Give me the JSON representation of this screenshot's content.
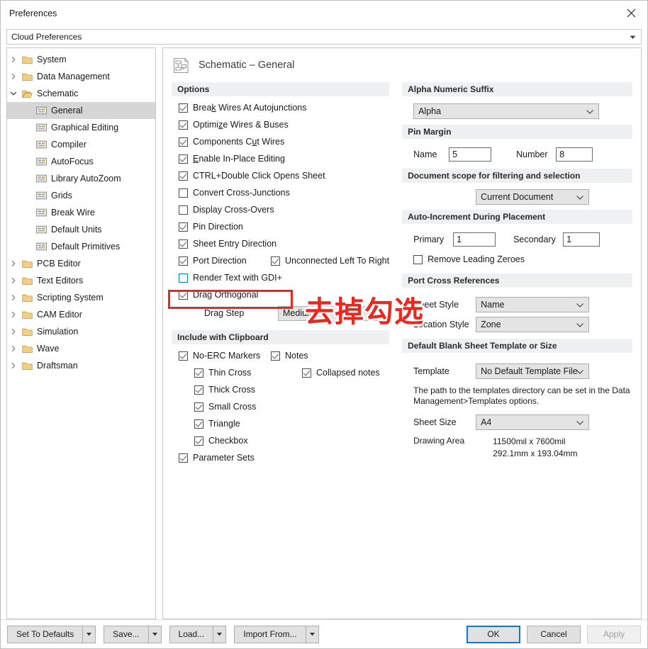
{
  "window": {
    "title": "Preferences",
    "close_icon": "close-icon"
  },
  "profile": {
    "value": "Cloud Preferences"
  },
  "tree": {
    "items": [
      {
        "label": "System",
        "level": 0,
        "expandable": true,
        "expanded": false,
        "icon": "folder-icon",
        "selected": false
      },
      {
        "label": "Data Management",
        "level": 0,
        "expandable": true,
        "expanded": false,
        "icon": "folder-icon",
        "selected": false
      },
      {
        "label": "Schematic",
        "level": 0,
        "expandable": true,
        "expanded": true,
        "icon": "folder-open-icon",
        "selected": false
      },
      {
        "label": "General",
        "level": 1,
        "expandable": false,
        "expanded": false,
        "icon": "page-icon",
        "selected": true
      },
      {
        "label": "Graphical Editing",
        "level": 1,
        "expandable": false,
        "expanded": false,
        "icon": "page-icon",
        "selected": false
      },
      {
        "label": "Compiler",
        "level": 1,
        "expandable": false,
        "expanded": false,
        "icon": "page-icon",
        "selected": false
      },
      {
        "label": "AutoFocus",
        "level": 1,
        "expandable": false,
        "expanded": false,
        "icon": "page-icon",
        "selected": false
      },
      {
        "label": "Library AutoZoom",
        "level": 1,
        "expandable": false,
        "expanded": false,
        "icon": "page-icon",
        "selected": false
      },
      {
        "label": "Grids",
        "level": 1,
        "expandable": false,
        "expanded": false,
        "icon": "page-icon",
        "selected": false
      },
      {
        "label": "Break Wire",
        "level": 1,
        "expandable": false,
        "expanded": false,
        "icon": "page-icon",
        "selected": false
      },
      {
        "label": "Default Units",
        "level": 1,
        "expandable": false,
        "expanded": false,
        "icon": "page-icon",
        "selected": false
      },
      {
        "label": "Default Primitives",
        "level": 1,
        "expandable": false,
        "expanded": false,
        "icon": "page-icon",
        "selected": false
      },
      {
        "label": "PCB Editor",
        "level": 0,
        "expandable": true,
        "expanded": false,
        "icon": "folder-icon",
        "selected": false
      },
      {
        "label": "Text Editors",
        "level": 0,
        "expandable": true,
        "expanded": false,
        "icon": "folder-icon",
        "selected": false
      },
      {
        "label": "Scripting System",
        "level": 0,
        "expandable": true,
        "expanded": false,
        "icon": "folder-icon",
        "selected": false
      },
      {
        "label": "CAM Editor",
        "level": 0,
        "expandable": true,
        "expanded": false,
        "icon": "folder-icon",
        "selected": false
      },
      {
        "label": "Simulation",
        "level": 0,
        "expandable": true,
        "expanded": false,
        "icon": "folder-icon",
        "selected": false
      },
      {
        "label": "Wave",
        "level": 0,
        "expandable": true,
        "expanded": false,
        "icon": "folder-icon",
        "selected": false
      },
      {
        "label": "Draftsman",
        "level": 0,
        "expandable": true,
        "expanded": false,
        "icon": "folder-icon",
        "selected": false
      }
    ]
  },
  "pane": {
    "icon": "schematic-icon",
    "title": "Schematic – General"
  },
  "options": {
    "header": "Options",
    "items": [
      {
        "label": "Break Wires At Autojunctions",
        "checked": true,
        "accel": "k"
      },
      {
        "label": "Optimize Wires & Buses",
        "checked": true,
        "accel": "z"
      },
      {
        "label": "Components Cut Wires",
        "checked": true,
        "accel": "u"
      },
      {
        "label": "Enable In-Place Editing",
        "checked": true,
        "accel": "E"
      },
      {
        "label": "CTRL+Double Click Opens Sheet",
        "checked": true,
        "accel": ""
      },
      {
        "label": "Convert Cross-Junctions",
        "checked": false,
        "accel": ""
      },
      {
        "label": "Display Cross-Overs",
        "checked": false,
        "accel": ""
      },
      {
        "label": "Pin Direction",
        "checked": true,
        "accel": ""
      },
      {
        "label": "Sheet Entry Direction",
        "checked": true,
        "accel": ""
      }
    ],
    "port_direction": {
      "label": "Port Direction",
      "checked": true
    },
    "unconnected_left_to_right": {
      "label": "Unconnected Left To Right",
      "checked": true
    },
    "render_text_gdi": {
      "label": "Render Text with GDI+",
      "checked": false,
      "focused": true
    },
    "drag_orthogonal": {
      "label": "Drag Orthogonal",
      "checked": true,
      "accel": "g"
    },
    "drag_step": {
      "label": "Drag Step",
      "value": "Medium"
    }
  },
  "clipboard": {
    "header": "Include with Clipboard",
    "no_erc_markers": {
      "label": "No-ERC Markers",
      "checked": true
    },
    "marker_children": [
      {
        "label": "Thin Cross",
        "checked": true
      },
      {
        "label": "Thick Cross",
        "checked": true
      },
      {
        "label": "Small Cross",
        "checked": true
      },
      {
        "label": "Triangle",
        "checked": true
      },
      {
        "label": "Checkbox",
        "checked": true
      }
    ],
    "parameter_sets": {
      "label": "Parameter Sets",
      "checked": true
    },
    "notes": {
      "label": "Notes",
      "checked": true
    },
    "collapsed_notes": {
      "label": "Collapsed notes",
      "checked": true
    }
  },
  "alpha_numeric_suffix": {
    "header": "Alpha Numeric Suffix",
    "value": "Alpha"
  },
  "pin_margin": {
    "header": "Pin Margin",
    "name_label": "Name",
    "name_value": "5",
    "number_label": "Number",
    "number_value": "8"
  },
  "document_scope": {
    "header": "Document scope for filtering and selection",
    "value": "Current Document"
  },
  "auto_increment": {
    "header": "Auto-Increment During Placement",
    "primary_label": "Primary",
    "primary_value": "1",
    "secondary_label": "Secondary",
    "secondary_value": "1",
    "remove_leading_zeroes": {
      "label": "Remove Leading Zeroes",
      "checked": false
    }
  },
  "port_cross_references": {
    "header": "Port Cross References",
    "sheet_style_label": "Sheet Style",
    "sheet_style_value": "Name",
    "location_style_label": "Location Style",
    "location_style_value": "Zone"
  },
  "default_sheet": {
    "header": "Default Blank Sheet Template or Size",
    "template_label": "Template",
    "template_value": "No Default Template File",
    "note": "The path to the templates directory can be set in the Data Management>Templates options.",
    "sheet_size_label": "Sheet Size",
    "sheet_size_value": "A4",
    "drawing_area_label": "Drawing Area",
    "drawing_area_mil": "11500mil x 7600mil",
    "drawing_area_mm": "292.1mm x 193.04mm"
  },
  "annotation": {
    "text": "去掉勾选",
    "color": "#e8291f"
  },
  "footer": {
    "set_to_defaults": "Set To Defaults",
    "save": "Save...",
    "load": "Load...",
    "import_from": "Import From...",
    "ok": "OK",
    "cancel": "Cancel",
    "apply": "Apply"
  }
}
